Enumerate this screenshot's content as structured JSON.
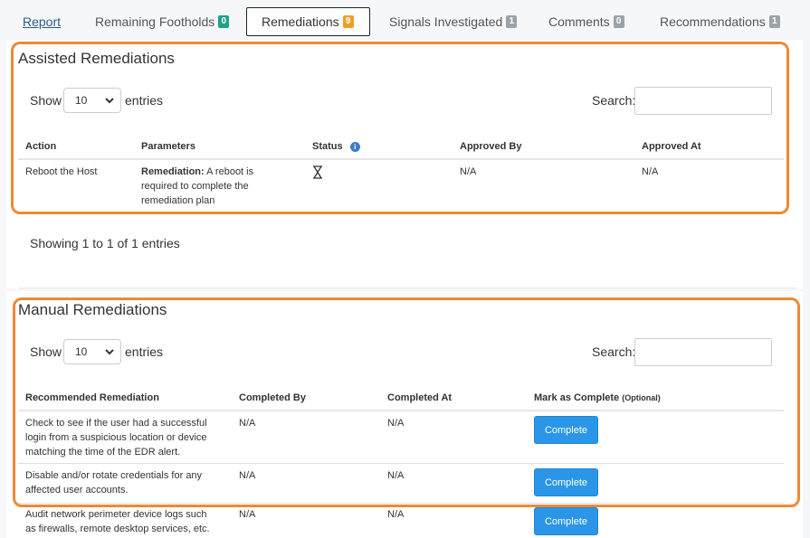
{
  "tabs": [
    {
      "label": "Report",
      "badge": ""
    },
    {
      "label": "Remaining Footholds",
      "badge": "0",
      "badge_color": "#20a08a"
    },
    {
      "label": "Remediations",
      "badge": "9",
      "badge_color": "#f0a020"
    },
    {
      "label": "Signals Investigated",
      "badge": "1",
      "badge_color": "#9aa3aa"
    },
    {
      "label": "Comments",
      "badge": "0",
      "badge_color": "#9aa3aa"
    },
    {
      "label": "Recommendations",
      "badge": "1",
      "badge_color": "#9aa3aa"
    }
  ],
  "assisted": {
    "title": "Assisted Remediations",
    "show_label": "Show",
    "entries_value": "10",
    "entries_label": "entries",
    "search_label": "Search:",
    "headers": {
      "action": "Action",
      "parameters": "Parameters",
      "status": "Status",
      "approved_by": "Approved By",
      "approved_at": "Approved At"
    },
    "rows": [
      {
        "action": "Reboot the Host",
        "param_bold": "Remediation:",
        "param_line1": " A reboot is",
        "param_line2": "required to complete the",
        "param_line3": "remediation plan",
        "approved_by": "N/A",
        "approved_at": "N/A"
      }
    ],
    "info": "Showing 1 to 1 of 1 entries"
  },
  "manual": {
    "title": "Manual Remediations",
    "show_label": "Show",
    "entries_value": "10",
    "entries_label": "entries",
    "search_label": "Search:",
    "headers": {
      "recommended": "Recommended Remediation",
      "completed_by": "Completed By",
      "completed_at": "Completed At",
      "mark_complete": "Mark as Complete",
      "optional": "(Optional)"
    },
    "rows": [
      {
        "lines": [
          "Check to see if the user had a successful",
          "login from a suspicious location or device",
          "matching the time of the EDR alert."
        ],
        "completed_by": "N/A",
        "completed_at": "N/A",
        "button": "Complete"
      },
      {
        "lines": [
          "Disable and/or rotate credentials for any",
          "affected user accounts."
        ],
        "completed_by": "N/A",
        "completed_at": "N/A",
        "button": "Complete"
      },
      {
        "lines": [
          "Audit network perimeter device logs such",
          "as firewalls, remote desktop services, etc."
        ],
        "completed_by": "N/A",
        "completed_at": "N/A",
        "button": "Complete"
      }
    ]
  },
  "colors": {
    "highlight": "#ee8a34",
    "button": "#2b96e8",
    "link": "#2f5a8a"
  }
}
